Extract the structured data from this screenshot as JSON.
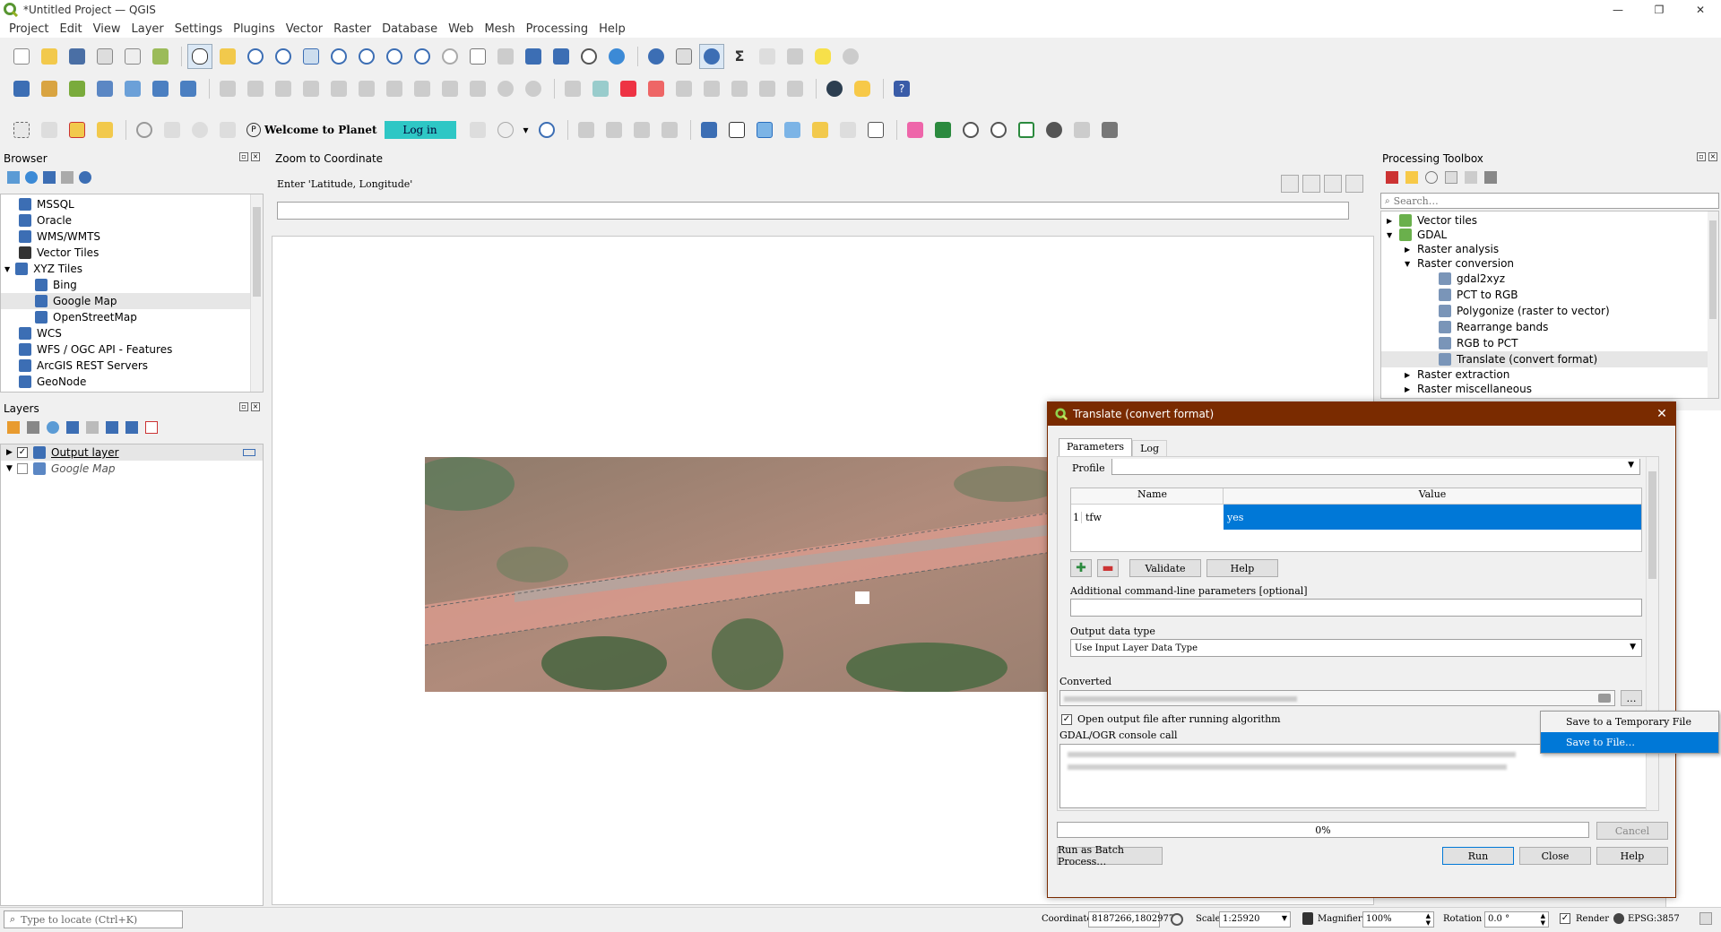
{
  "window": {
    "title": "*Untitled Project — QGIS"
  },
  "menu": [
    "Project",
    "Edit",
    "View",
    "Layer",
    "Settings",
    "Plugins",
    "Vector",
    "Raster",
    "Database",
    "Web",
    "Mesh",
    "Processing",
    "Help"
  ],
  "planet": {
    "welcome": "Welcome to Planet",
    "login": "Log in"
  },
  "browser": {
    "title": "Browser",
    "items": [
      {
        "label": "MSSQL",
        "indent": 1
      },
      {
        "label": "Oracle",
        "indent": 1
      },
      {
        "label": "WMS/WMTS",
        "indent": 1
      },
      {
        "label": "Vector Tiles",
        "indent": 1
      },
      {
        "label": "XYZ Tiles",
        "indent": 1
      },
      {
        "label": "Bing",
        "indent": 2
      },
      {
        "label": "Google Map",
        "indent": 2
      },
      {
        "label": "OpenStreetMap",
        "indent": 2
      },
      {
        "label": "WCS",
        "indent": 1
      },
      {
        "label": "WFS / OGC API - Features",
        "indent": 1
      },
      {
        "label": "ArcGIS REST Servers",
        "indent": 1
      },
      {
        "label": "GeoNode",
        "indent": 1
      }
    ]
  },
  "layers": {
    "title": "Layers",
    "items": [
      {
        "label": "Output layer",
        "checked": true
      },
      {
        "label": "Google Map",
        "checked": false
      }
    ]
  },
  "zoom": {
    "title": "Zoom to Coordinate",
    "hint": "Enter 'Latitude, Longitude'"
  },
  "toolbox": {
    "title": "Processing Toolbox",
    "search_placeholder": "Search…",
    "items": [
      {
        "label": "Vector tiles",
        "level": 0
      },
      {
        "label": "GDAL",
        "level": 0
      },
      {
        "label": "Raster analysis",
        "level": 1
      },
      {
        "label": "Raster conversion",
        "level": 1
      },
      {
        "label": "gdal2xyz",
        "level": 2
      },
      {
        "label": "PCT to RGB",
        "level": 2
      },
      {
        "label": "Polygonize (raster to vector)",
        "level": 2
      },
      {
        "label": "Rearrange bands",
        "level": 2
      },
      {
        "label": "RGB to PCT",
        "level": 2
      },
      {
        "label": "Translate (convert format)",
        "level": 2
      },
      {
        "label": "Raster extraction",
        "level": 1
      },
      {
        "label": "Raster miscellaneous",
        "level": 1
      }
    ]
  },
  "dialog": {
    "title": "Translate (convert format)",
    "tabs": [
      "Parameters",
      "Log"
    ],
    "profile_label": "Profile",
    "table": {
      "headers": [
        "Name",
        "Value"
      ],
      "row": {
        "index": "1",
        "name": "tfw",
        "value": "yes"
      }
    },
    "validate": "Validate",
    "help_small": "Help",
    "add_params_label": "Additional command-line parameters [optional]",
    "output_type_label": "Output data type",
    "output_type_value": "Use Input Layer Data Type",
    "converted_label": "Converted",
    "open_output": "Open output file after running algorithm",
    "console_label": "GDAL/OGR console call",
    "progress": "0%",
    "cancel": "Cancel",
    "batch": "Run as Batch Process…",
    "run": "Run",
    "close": "Close",
    "help": "Help",
    "popup": [
      "Save to a Temporary File",
      "Save to File…"
    ]
  },
  "statusbar": {
    "locate_placeholder": "Type to locate (Ctrl+K)",
    "coordinate_label": "Coordinate",
    "coordinate_value": "8187266,1802977",
    "scale_label": "Scale",
    "scale_value": "1:25920",
    "magnifier_label": "Magnifier",
    "magnifier_value": "100%",
    "rotation_label": "Rotation",
    "rotation_value": "0.0 °",
    "render_label": "Render",
    "crs": "EPSG:3857"
  }
}
